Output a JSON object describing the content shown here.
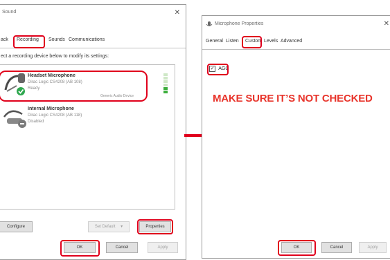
{
  "left_dialog": {
    "title": "Sound",
    "tabs": [
      "ack",
      "Recording",
      "Sounds",
      "Communications"
    ],
    "instruction": "ect a recording device below to modify its settings:",
    "devices": [
      {
        "name": "Headset Microphone",
        "detail": "Dirac Logic CS4208 (AB 108)",
        "status": "Ready",
        "badge": "Generic Audio Device"
      },
      {
        "name": "Internal Microphone",
        "detail": "Dirac Logic CS4208 (AB 118)",
        "status": "Disabled"
      }
    ],
    "buttons": {
      "configure": "Configure",
      "set_default": "Set Default",
      "properties": "Properties",
      "ok": "OK",
      "cancel": "Cancel",
      "apply": "Apply"
    }
  },
  "right_dialog": {
    "title": "Microphone Properties",
    "tabs": [
      "General",
      "Listen",
      "Custom",
      "Levels",
      "Advanced"
    ],
    "checkbox_label": "AGC",
    "checkbox_checked": true,
    "annotation": "MAKE SURE IT’S NOT CHECKED",
    "buttons": {
      "ok": "OK",
      "cancel": "Cancel",
      "apply": "Apply"
    },
    "close_glyph": "✕"
  },
  "colors": {
    "highlight": "#e0001b",
    "annotation": "#e8342b",
    "arrow": "#e0001b"
  },
  "icons": {
    "microphone": "headset-microphone-icon",
    "arrow": "arrow-right-icon"
  }
}
